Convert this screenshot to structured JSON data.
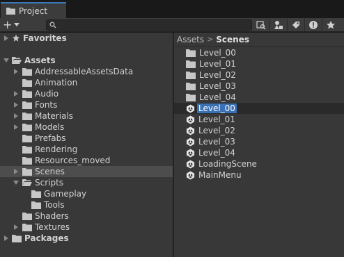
{
  "tab": {
    "title": "Project"
  },
  "toolbar": {
    "add_label": "+",
    "search_placeholder": "",
    "icons": [
      "search-icon",
      "search-by-type-icon",
      "filter-by-label-icon",
      "hidden-packages-icon",
      "favorite-star-icon"
    ]
  },
  "tree": {
    "favorites": "Favorites",
    "assets": "Assets",
    "children": [
      {
        "label": "AddressableAssetsData",
        "expandable": true
      },
      {
        "label": "Animation",
        "expandable": false
      },
      {
        "label": "Audio",
        "expandable": true
      },
      {
        "label": "Fonts",
        "expandable": true
      },
      {
        "label": "Materials",
        "expandable": true
      },
      {
        "label": "Models",
        "expandable": true
      },
      {
        "label": "Prefabs",
        "expandable": false
      },
      {
        "label": "Rendering",
        "expandable": false
      },
      {
        "label": "Resources_moved",
        "expandable": false
      },
      {
        "label": "Scenes",
        "expandable": true,
        "selected": true
      },
      {
        "label": "Scripts",
        "expandable": true,
        "expanded": true
      },
      {
        "label": "Gameplay",
        "expandable": false,
        "depth": 2
      },
      {
        "label": "Tools",
        "expandable": false,
        "depth": 2
      },
      {
        "label": "Shaders",
        "expandable": false
      },
      {
        "label": "Textures",
        "expandable": true
      }
    ],
    "packages": "Packages"
  },
  "breadcrumb": {
    "root": "Assets",
    "separator": ">",
    "current": "Scenes"
  },
  "content": {
    "folders": [
      "Level_00",
      "Level_01",
      "Level_02",
      "Level_03",
      "Level_04"
    ],
    "scenes": [
      "Level_00",
      "Level_01",
      "Level_02",
      "Level_03",
      "Level_04",
      "LoadingScene",
      "MainMenu"
    ],
    "renaming_scene": "Level_00"
  },
  "colors": {
    "accent": "#3a70b4",
    "panel": "#383838",
    "folder": "#c7c7c7"
  }
}
